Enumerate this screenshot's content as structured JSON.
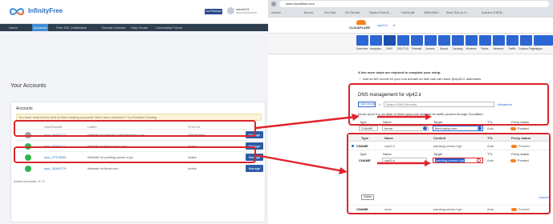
{
  "left": {
    "brand": "InfinityFree",
    "header_button": "Go Premium",
    "user": "sohel123",
    "nav": [
      "Home",
      "Accounts",
      "Free SSL Certificates",
      "Domain Checker",
      "Help Center",
      "Community Forum"
    ],
    "page_title": "Your Accounts",
    "card_title": "Accounts",
    "notice": "You have reached the limit of three hosting accounts! Need more websites? Try Premium Hosting",
    "table_headers": [
      "USERNAME",
      "LABEL",
      "STATUS"
    ],
    "rows": [
      {
        "username": "epiz_26461172",
        "label": "Website for dialog41.infinityfreeapp.com",
        "status": "Deactivated",
        "color": "#9aa3ad"
      },
      {
        "username": "epiz_26301171",
        "label": "Website for ftimd.epizy.com",
        "status": "Active",
        "color": "#2bb64c"
      },
      {
        "username": "epiz_27978530",
        "label": "Website for painting-persia.rf.gd",
        "status": "Active",
        "color": "#2bb64c"
      },
      {
        "username": "epiz_28183779",
        "label": "Website for ftimd.com",
        "status": "Active",
        "color": "#2bb64c"
      }
    ],
    "manage_label": "Manage",
    "footer": "Active Accounts: 3 / 3"
  },
  "right": {
    "url": "dash.cloudflare.com",
    "bookmarks": [
      "usefull",
      "Torrent",
      "Sci-Hub",
      "IDI Rehab",
      "Speed Test M...",
      "HotSLAB",
      "ARDUINO",
      "Best Text-to-S...",
      "Arduino ESP8..."
    ],
    "brand": "CLOUDFLARE",
    "zone_selector": "vip42.ir",
    "icons": [
      "Overview",
      "Analytics",
      "DNS",
      "SSL/TLS",
      "Firewall",
      "Access",
      "Speed",
      "Caching",
      "Workers",
      "Rules",
      "Network",
      "Traffic",
      "Custom Pages",
      "Apps",
      "Scrape Shield"
    ],
    "setup_title": "A few more steps are required to complete your setup.",
    "setup_item": "Add an MX record for your root domain so that mail can reach @vip42.ir addresses.",
    "dns_title": "DNS management for vip42.ir",
    "add_record": "+ Add record",
    "search_placeholder": "Search DNS Records",
    "advanced": "Advanced",
    "alias_note": "forum.vip42.ir is an alias of ftimd.epizy.com and has its traffic proxied through Cloudflare.",
    "labels": {
      "type": "Type",
      "name": "Name",
      "target": "Target",
      "ttl": "TTL",
      "proxy": "Proxy status",
      "content": "Content"
    },
    "edit1": {
      "type": "CNAME",
      "name": "forum",
      "target": "ftimd.epizy.com",
      "ttl": "Auto",
      "proxy": "Proxied"
    },
    "cancel": "Cancel",
    "record_row": {
      "type": "CNAME",
      "name": "vip42.ir",
      "content": "painting-persia.rf.gd",
      "ttl": "Auto",
      "proxy": "Proxied"
    },
    "edit2": {
      "type": "CNAME",
      "name": "vip42.ir",
      "target": "painting-persia.rf.gd",
      "ttl": "Auto",
      "proxy": "Proxied"
    },
    "delete": "Delete",
    "bottom_row": {
      "type": "CNAME",
      "name": "www",
      "content": "painting-persia.rf.gd",
      "ttl": "Auto",
      "proxy": "Proxied"
    }
  },
  "colors": {
    "accent_red": "#d9252b",
    "cf_blue": "#2c66d3",
    "cf_orange": "#f6821f",
    "if_green": "#2bb64c",
    "if_nav": "#2d3e4f"
  }
}
